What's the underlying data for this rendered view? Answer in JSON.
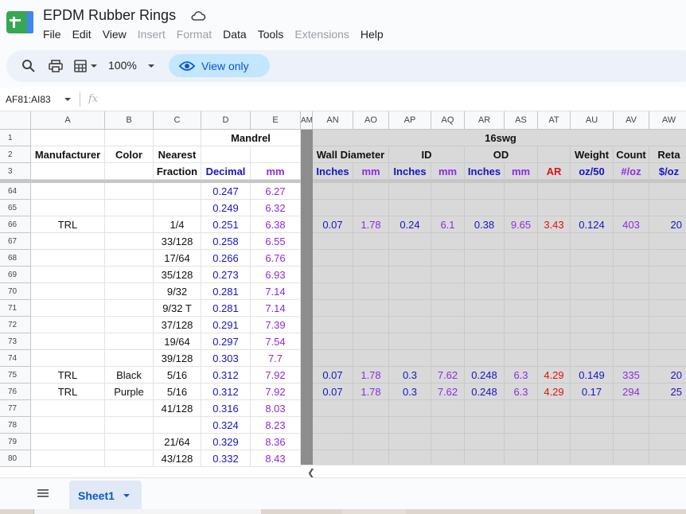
{
  "document": {
    "title": "EPDM Rubber Rings"
  },
  "menu": [
    "File",
    "Edit",
    "View",
    "Insert",
    "Format",
    "Data",
    "Tools",
    "Extensions",
    "Help"
  ],
  "menu_disabled": [
    "Insert",
    "Format",
    "Extensions"
  ],
  "toolbar": {
    "zoom": "100%",
    "view_only": "View only"
  },
  "formula_bar": {
    "name_box": "AF81:AI83",
    "fx": "fx"
  },
  "columns_left": [
    "A",
    "B",
    "C",
    "D",
    "E"
  ],
  "columns_right": [
    "AN",
    "AO",
    "AP",
    "AQ",
    "AR",
    "AS",
    "AT",
    "AU",
    "AV",
    "AW"
  ],
  "partial_column": "AM",
  "header": {
    "mandrel": "Mandrel",
    "group16": "16swg",
    "manufacturer": "Manufacturer",
    "color": "Color",
    "nearest": "Nearest",
    "fraction": "Fraction",
    "decimal": "Decimal",
    "mm": "mm",
    "wall_diameter": "Wall Diameter",
    "id": "ID",
    "od": "OD",
    "weight": "Weight",
    "count": "Count",
    "retail": "Reta",
    "sub": [
      "Inches",
      "mm",
      "Inches",
      "mm",
      "Inches",
      "mm",
      "AR",
      "oz/50",
      "#/oz",
      "$/oz"
    ]
  },
  "header_rows": [
    "1",
    "2",
    "3"
  ],
  "rows": [
    {
      "n": "64",
      "a": "",
      "b": "",
      "c": "",
      "d": "0.247",
      "e": "6.27",
      "r": []
    },
    {
      "n": "65",
      "a": "",
      "b": "",
      "c": "",
      "d": "0.249",
      "e": "6.32",
      "r": []
    },
    {
      "n": "66",
      "a": "TRL",
      "b": "",
      "c": "1/4",
      "d": "0.251",
      "e": "6.38",
      "r": [
        "0.07",
        "1.78",
        "0.24",
        "6.1",
        "0.38",
        "9.65",
        "3.43",
        "0.124",
        "403",
        "20"
      ]
    },
    {
      "n": "67",
      "a": "",
      "b": "",
      "c": "33/128",
      "d": "0.258",
      "e": "6.55",
      "r": []
    },
    {
      "n": "68",
      "a": "",
      "b": "",
      "c": "17/64",
      "d": "0.266",
      "e": "6.76",
      "r": []
    },
    {
      "n": "69",
      "a": "",
      "b": "",
      "c": "35/128",
      "d": "0.273",
      "e": "6.93",
      "r": []
    },
    {
      "n": "70",
      "a": "",
      "b": "",
      "c": "9/32",
      "d": "0.281",
      "e": "7.14",
      "r": []
    },
    {
      "n": "71",
      "a": "",
      "b": "",
      "c": "9/32 T",
      "d": "0.281",
      "e": "7.14",
      "r": []
    },
    {
      "n": "72",
      "a": "",
      "b": "",
      "c": "37/128",
      "d": "0.291",
      "e": "7.39",
      "r": []
    },
    {
      "n": "73",
      "a": "",
      "b": "",
      "c": "19/64",
      "d": "0.297",
      "e": "7.54",
      "r": []
    },
    {
      "n": "74",
      "a": "",
      "b": "",
      "c": "39/128",
      "d": "0.303",
      "e": "7.7",
      "r": []
    },
    {
      "n": "75",
      "a": "TRL",
      "b": "Black",
      "c": "5/16",
      "d": "0.312",
      "e": "7.92",
      "r": [
        "0.07",
        "1.78",
        "0.3",
        "7.62",
        "0.248",
        "6.3",
        "4.29",
        "0.149",
        "335",
        "20"
      ]
    },
    {
      "n": "76",
      "a": "TRL",
      "b": "Purple",
      "c": "5/16",
      "d": "0.312",
      "e": "7.92",
      "r": [
        "0.07",
        "1.78",
        "0.3",
        "7.62",
        "0.248",
        "6.3",
        "4.29",
        "0.17",
        "294",
        "25"
      ]
    },
    {
      "n": "77",
      "a": "",
      "b": "",
      "c": "41/128",
      "d": "0.316",
      "e": "8.03",
      "r": []
    },
    {
      "n": "78",
      "a": "",
      "b": "",
      "c": "",
      "d": "0.324",
      "e": "8.23",
      "r": []
    },
    {
      "n": "79",
      "a": "",
      "b": "",
      "c": "21/64",
      "d": "0.329",
      "e": "8.36",
      "r": []
    },
    {
      "n": "80",
      "a": "",
      "b": "",
      "c": "43/128",
      "d": "0.332",
      "e": "8.43",
      "r": []
    }
  ],
  "sheets": [
    {
      "name": "Sheet1",
      "active": true
    }
  ],
  "colors": {
    "blue": "#1515c8",
    "purple": "#8a2be2",
    "red": "#e01010",
    "gray_fill": "#d9d9d9",
    "accent": "#0b57d0"
  }
}
